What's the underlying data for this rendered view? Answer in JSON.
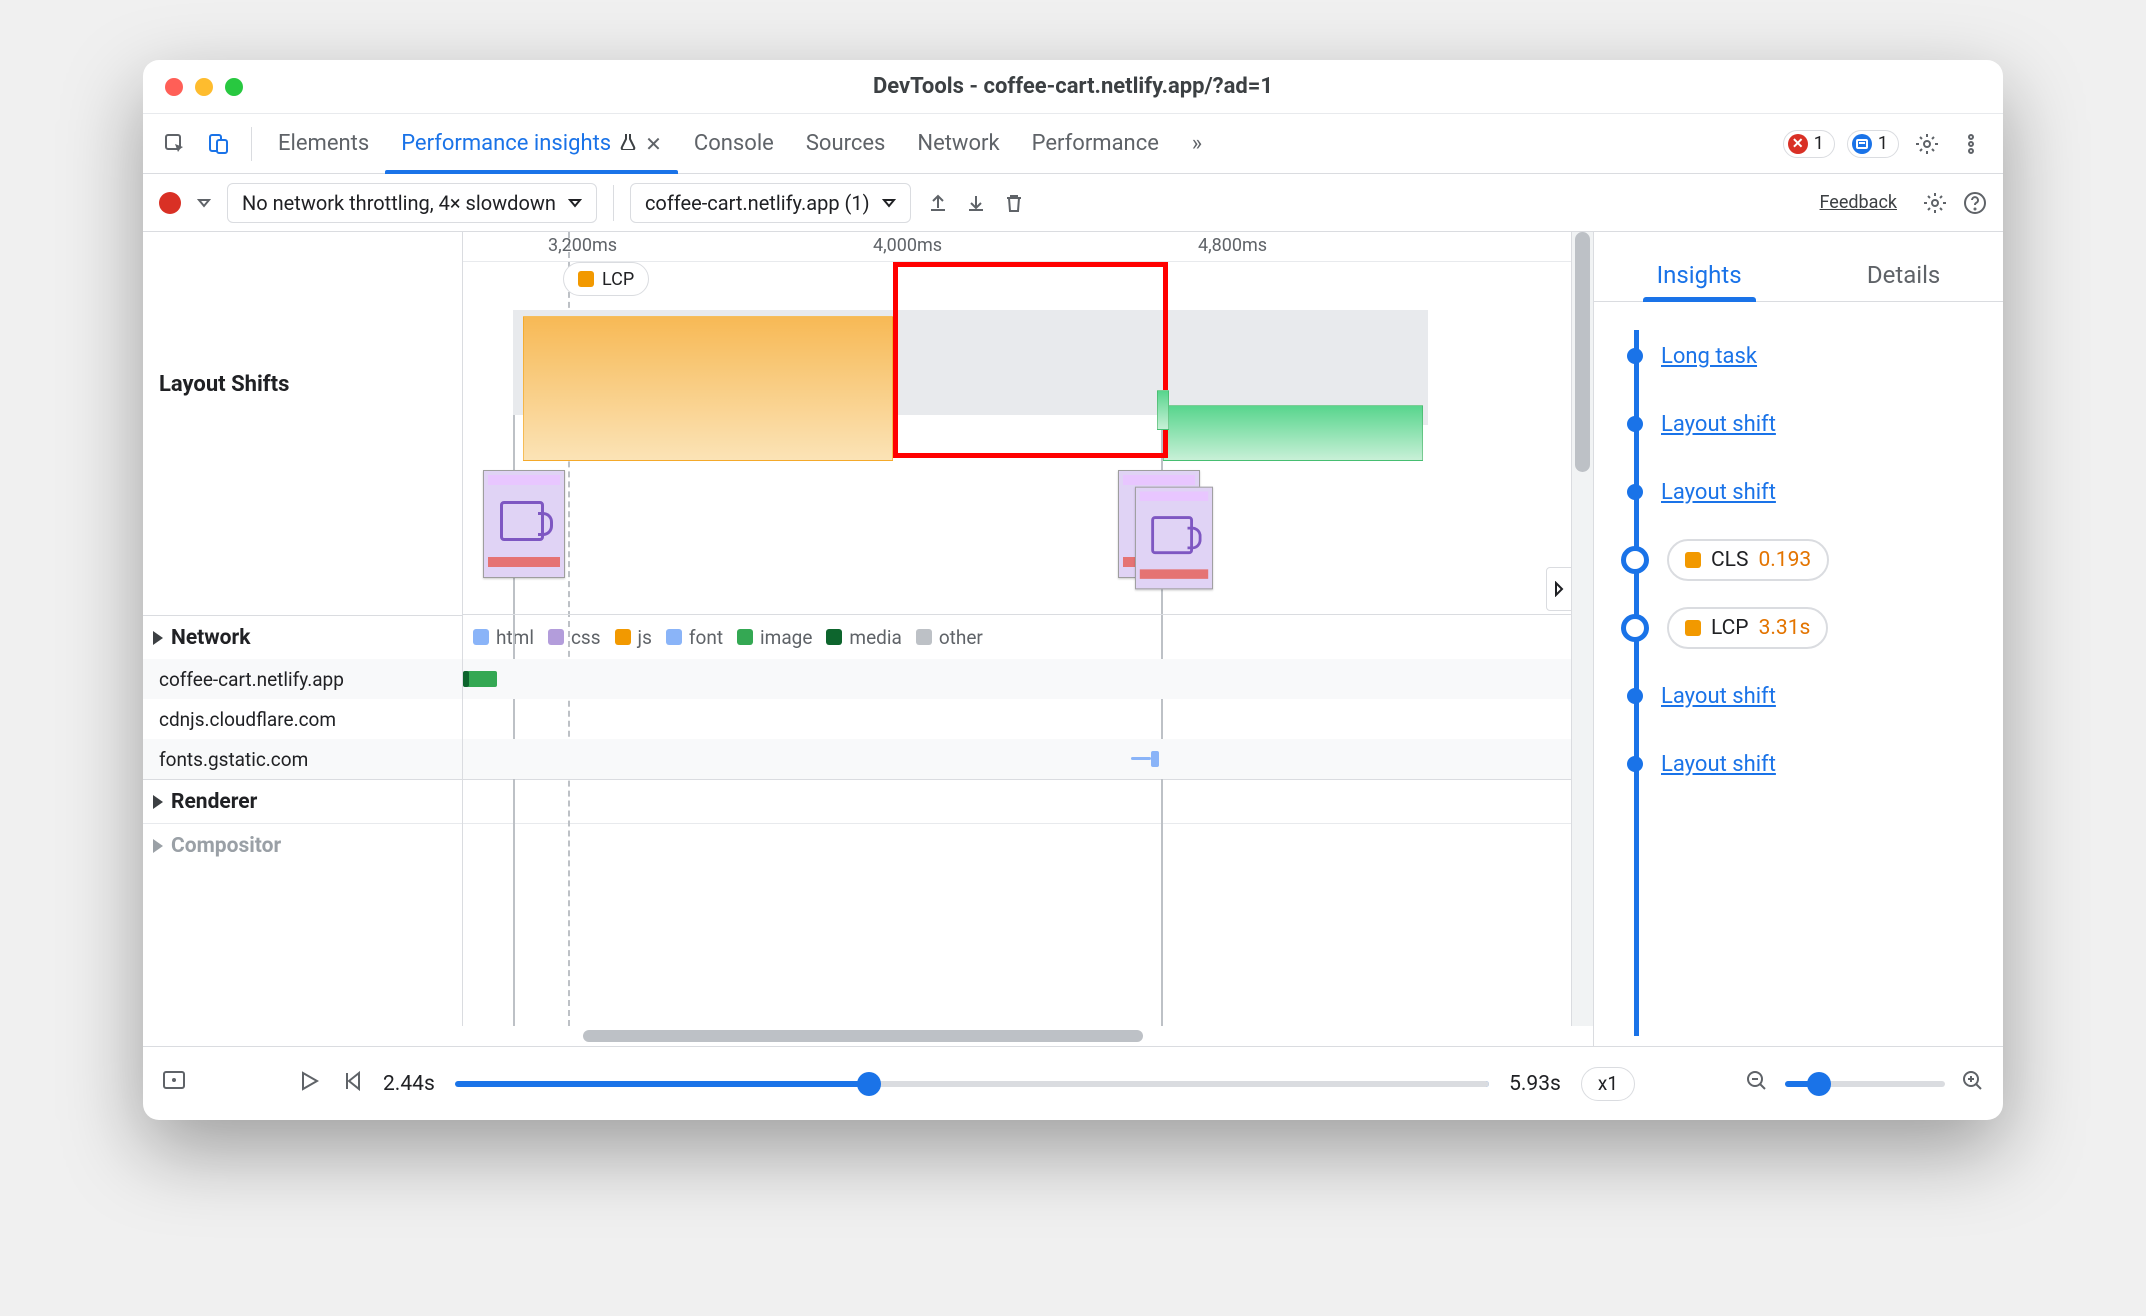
{
  "window": {
    "title": "DevTools - coffee-cart.netlify.app/?ad=1"
  },
  "tabs": {
    "items": [
      "Elements",
      "Performance insights",
      "Console",
      "Sources",
      "Network",
      "Performance"
    ],
    "active_index": 1,
    "error_count": "1",
    "info_count": "1"
  },
  "toolbar": {
    "throttle": "No network throttling, 4× slowdown",
    "recording": "coffee-cart.netlify.app (1)",
    "feedback": "Feedback"
  },
  "timeline": {
    "ticks": [
      "3,200ms",
      "4,000ms",
      "4,800ms"
    ],
    "lcp_pill": "LCP",
    "layout_shifts_label": "Layout Shifts",
    "network_label": "Network",
    "renderer_label": "Renderer",
    "compositor_label": "Compositor",
    "legend": [
      "html",
      "css",
      "js",
      "font",
      "image",
      "media",
      "other"
    ],
    "hosts": [
      "coffee-cart.netlify.app",
      "cdnjs.cloudflare.com",
      "fonts.gstatic.com"
    ]
  },
  "insights": {
    "tab_insights": "Insights",
    "tab_details": "Details",
    "items": [
      {
        "type": "link",
        "label": "Long task"
      },
      {
        "type": "link",
        "label": "Layout shift"
      },
      {
        "type": "link",
        "label": "Layout shift"
      },
      {
        "type": "pill",
        "metric": "CLS",
        "value": "0.193",
        "color": "orange"
      },
      {
        "type": "pill",
        "metric": "LCP",
        "value": "3.31s",
        "color": "orange"
      },
      {
        "type": "link",
        "label": "Layout shift"
      },
      {
        "type": "link",
        "label": "Layout shift"
      }
    ]
  },
  "footer": {
    "time_start": "2.44s",
    "time_end": "5.93s",
    "speed": "x1"
  }
}
